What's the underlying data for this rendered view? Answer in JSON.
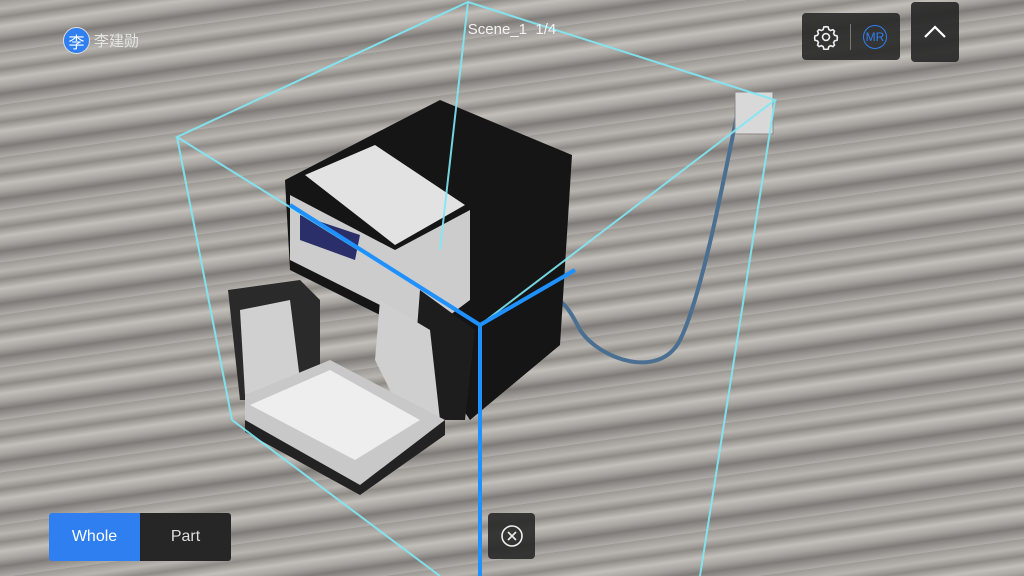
{
  "header": {
    "scene_title": "Scene_1  1/4"
  },
  "user": {
    "avatar_initial": "李",
    "name": "李建勋"
  },
  "toolbar": {
    "settings_icon": "gear-icon",
    "mode_label": "MR",
    "collapse_icon": "chevron-up-icon"
  },
  "view_mode": {
    "options": [
      {
        "label": "Whole",
        "selected": true
      },
      {
        "label": "Part",
        "selected": false
      }
    ]
  },
  "close_icon": "close-circle-icon",
  "colors": {
    "accent": "#2f7ff0",
    "bounding_box": "#7fe8f5"
  }
}
